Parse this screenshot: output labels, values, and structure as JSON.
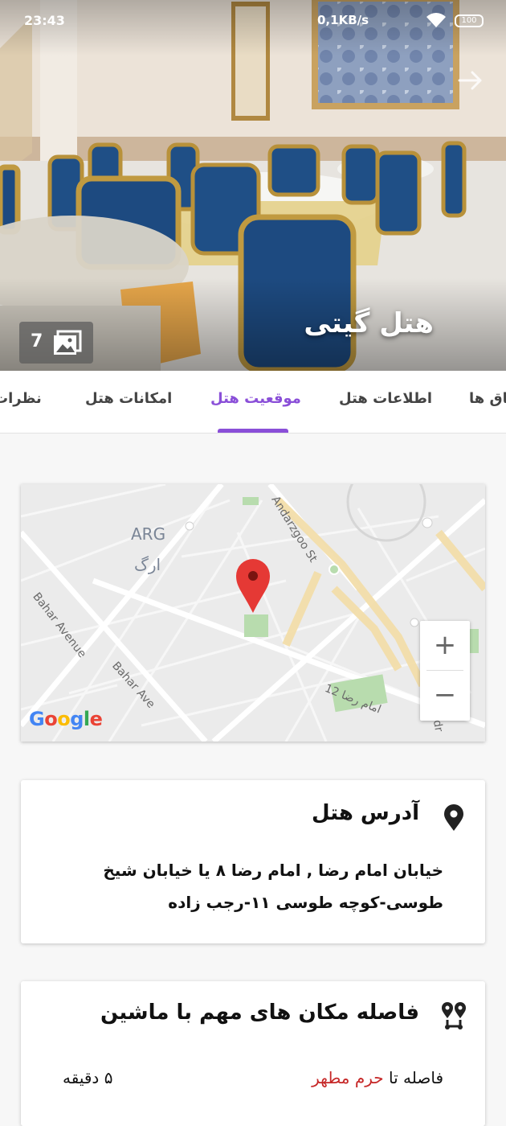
{
  "status_bar": {
    "time": "23:43",
    "network_speed": "0,1KB/s",
    "battery": "100"
  },
  "hero": {
    "title": "هتل گیتی",
    "photo_count": "7",
    "forward_icon": "arrow-right-icon",
    "gallery_icon": "image-gallery-icon"
  },
  "tabs": [
    {
      "label": "اتاق ها"
    },
    {
      "label": "اطلاعات هتل"
    },
    {
      "label": "موقعیت هتل",
      "active": true
    },
    {
      "label": "امکانات هتل"
    },
    {
      "label": "نظرات"
    }
  ],
  "map": {
    "labels": {
      "arg_en": "ARG",
      "arg_fa": "ارگ",
      "bahar_avenue": "Bahar Avenue",
      "bahar_ave": "Bahar Ave",
      "andarzgoo": "Andarzgoo St",
      "imam_reza": "امام رضا 12",
      "edge_street": "N Sadr"
    },
    "zoom_in": "+",
    "zoom_out": "−",
    "attribution": "Google"
  },
  "address_card": {
    "title": "آدرس هتل",
    "icon": "location-pin-icon",
    "text": "خیابان امام رضا , امام رضا ۸ یا خیابان شیخ طوسی-کوچه طوسی ۱۱-رجب زاده"
  },
  "distance_card": {
    "title": "فاصله مکان های مهم با ماشین",
    "icon": "route-map-icon",
    "rows": [
      {
        "prefix": "فاصله تا",
        "place": "حرم مطهر",
        "time": "۵ دقیقه"
      }
    ]
  },
  "colors": {
    "accent": "#8a4fd8",
    "place_highlight": "#c62828",
    "map_pin": "#e53935"
  }
}
